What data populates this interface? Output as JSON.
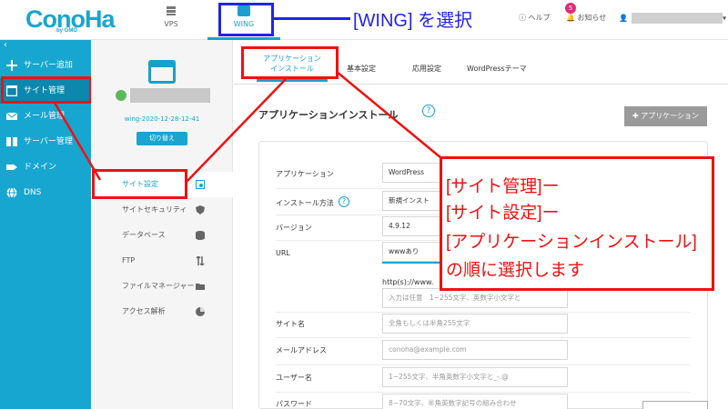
{
  "header": {
    "logo": "ConoHa",
    "logo_sub": "by GMO",
    "tab_vps": "VPS",
    "tab_wing": "WING",
    "help": "ヘルプ",
    "notice": "お知らせ",
    "notice_badge": "5"
  },
  "annotation_top": "[WING] を選択",
  "sidebar": {
    "items": [
      {
        "label": "サーバー追加",
        "icon": "plus-icon"
      },
      {
        "label": "サイト管理",
        "icon": "window-icon"
      },
      {
        "label": "メール管理",
        "icon": "mail-icon"
      },
      {
        "label": "サーバー管理",
        "icon": "server-icon"
      },
      {
        "label": "ドメイン",
        "icon": "tag-icon"
      },
      {
        "label": "DNS",
        "icon": "globe-icon"
      }
    ]
  },
  "site_panel": {
    "site_id": "wing-2020-12-28-12-41",
    "switch_label": "切り替え",
    "items": [
      {
        "label": "サイト設定",
        "icon": "gear-icon"
      },
      {
        "label": "サイトセキュリティ",
        "icon": "shield-icon"
      },
      {
        "label": "データベース",
        "icon": "database-icon"
      },
      {
        "label": "FTP",
        "icon": "transfer-icon"
      },
      {
        "label": "ファイルマネージャー",
        "icon": "folder-icon"
      },
      {
        "label": "アクセス解析",
        "icon": "pie-chart-icon"
      }
    ]
  },
  "main": {
    "tabs": [
      {
        "label_line1": "アプリケーション",
        "label_line2": "インストール"
      },
      {
        "label": "基本設定"
      },
      {
        "label": "応用設定"
      },
      {
        "label": "WordPressテーマ"
      }
    ],
    "section_title": "アプリケーションインストール",
    "add_button": "アプリケーション",
    "form": {
      "application_label": "アプリケーション",
      "application_value": "WordPress",
      "install_method_label": "インストール方法",
      "install_method_value": "新規インスト",
      "version_label": "バージョン",
      "version_value": "4.9.12",
      "url_label": "URL",
      "url_value": "wwwあり",
      "url_prefix": "http(s)://www.",
      "url_path_placeholder": "入力は任意　1~255文字、英数字小文字と",
      "site_name_label": "サイト名",
      "site_name_placeholder": "全角もしくは半角255文字",
      "email_label": "メールアドレス",
      "email_placeholder": "conoha@example.com",
      "username_label": "ユーザー名",
      "username_placeholder": "1~255文字、半角英数字小文字と_-.@",
      "password_label": "パスワード",
      "password_placeholder": "8~70文字、半角英数字記号の組み合わせ"
    }
  },
  "annotation_note": [
    "[サイト管理]ー",
    "[サイト設定]ー",
    "[アプリケーションインストール]",
    "の順に選択します"
  ],
  "colors": {
    "brand": "#17a6cf",
    "annotation_red": "#ee1111",
    "annotation_blue": "#2222ee"
  }
}
